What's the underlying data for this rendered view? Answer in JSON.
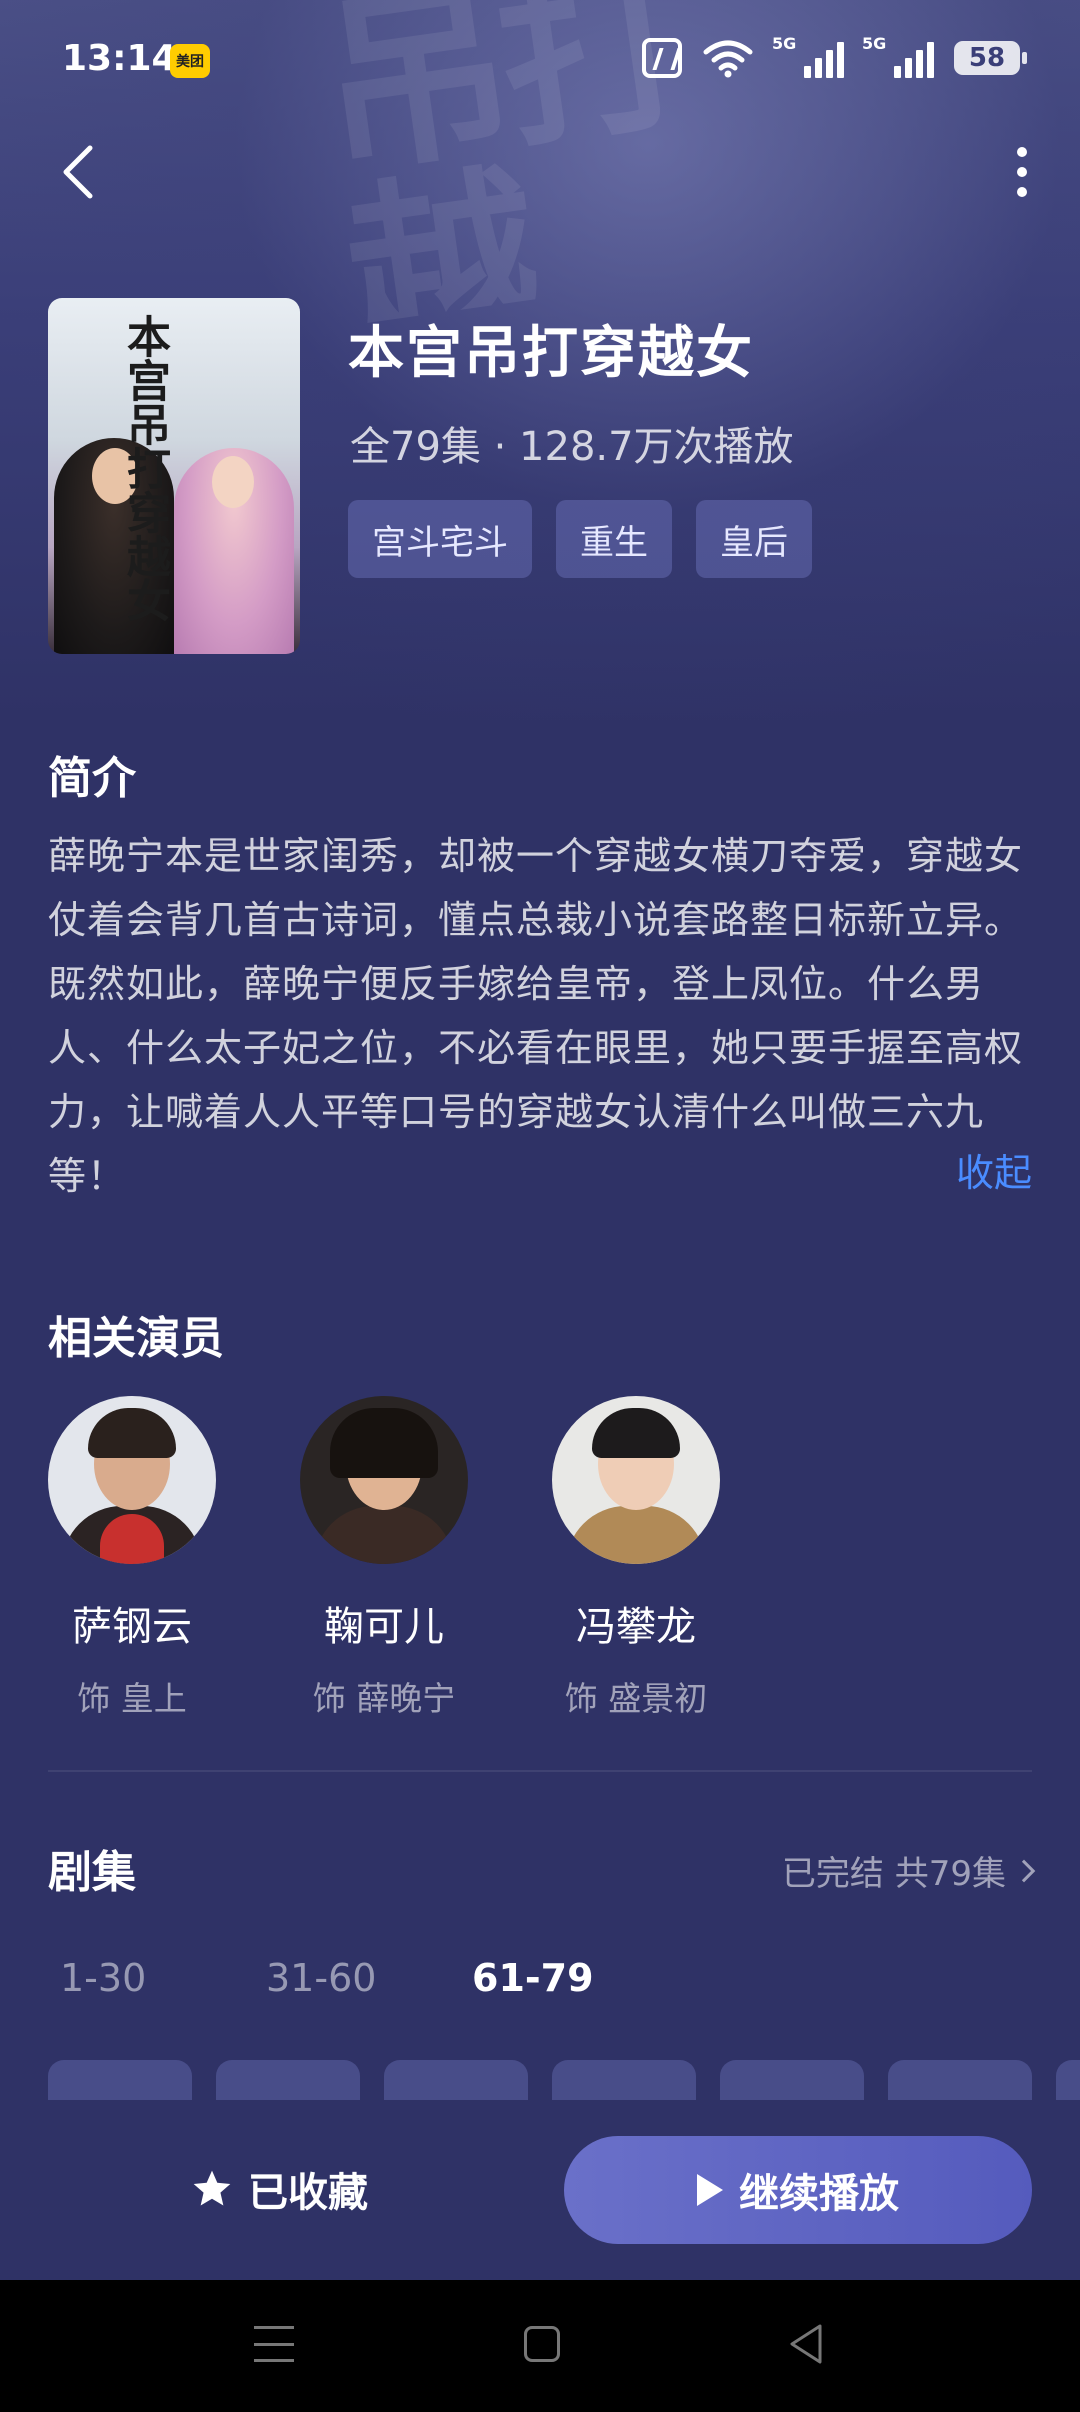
{
  "status_bar": {
    "time": "13:14",
    "app_badge": "美团",
    "icons": [
      "nfc-icon",
      "wifi-icon",
      "signal-5g-icon",
      "signal-5g-icon",
      "battery-icon"
    ],
    "sig_label": "5G",
    "battery": "58"
  },
  "header": {
    "back_icon": "back-chevron-icon",
    "more_icon": "more-vertical-icon",
    "watermark": "吊打越"
  },
  "drama": {
    "poster_title": "本宫吊打穿越女",
    "title": "本宫吊打穿越女",
    "meta": "全79集 · 128.7万次播放",
    "tags": [
      "宫斗宅斗",
      "重生",
      "皇后"
    ]
  },
  "synopsis": {
    "title": "简介",
    "text": "薛晚宁本是世家闺秀，却被一个穿越女横刀夺爱，穿越女仗着会背几首古诗词，懂点总裁小说套路整日标新立异。既然如此，薛晚宁便反手嫁给皇帝，登上凤位。什么男人、什么太子妃之位，不必看在眼里，她只要手握至高权力，让喊着人人平等口号的穿越女认清什么叫做三六九等！",
    "collapse_label": "收起"
  },
  "cast": {
    "title": "相关演员",
    "members": [
      {
        "name": "萨钢云",
        "role": "饰 皇上"
      },
      {
        "name": "鞠可儿",
        "role": "饰 薛晚宁"
      },
      {
        "name": "冯攀龙",
        "role": "饰 盛景初"
      }
    ]
  },
  "episodes": {
    "title": "剧集",
    "status": "已完结 共79集",
    "tabs": [
      "1-30",
      "31-60",
      "61-79"
    ],
    "active_tab": "61-79"
  },
  "actions": {
    "favorite_label": "已收藏",
    "play_label": "继续播放"
  },
  "colors": {
    "background": "#2f3266",
    "accent_link": "#4a8cff",
    "play_button": "#5f65c4"
  }
}
